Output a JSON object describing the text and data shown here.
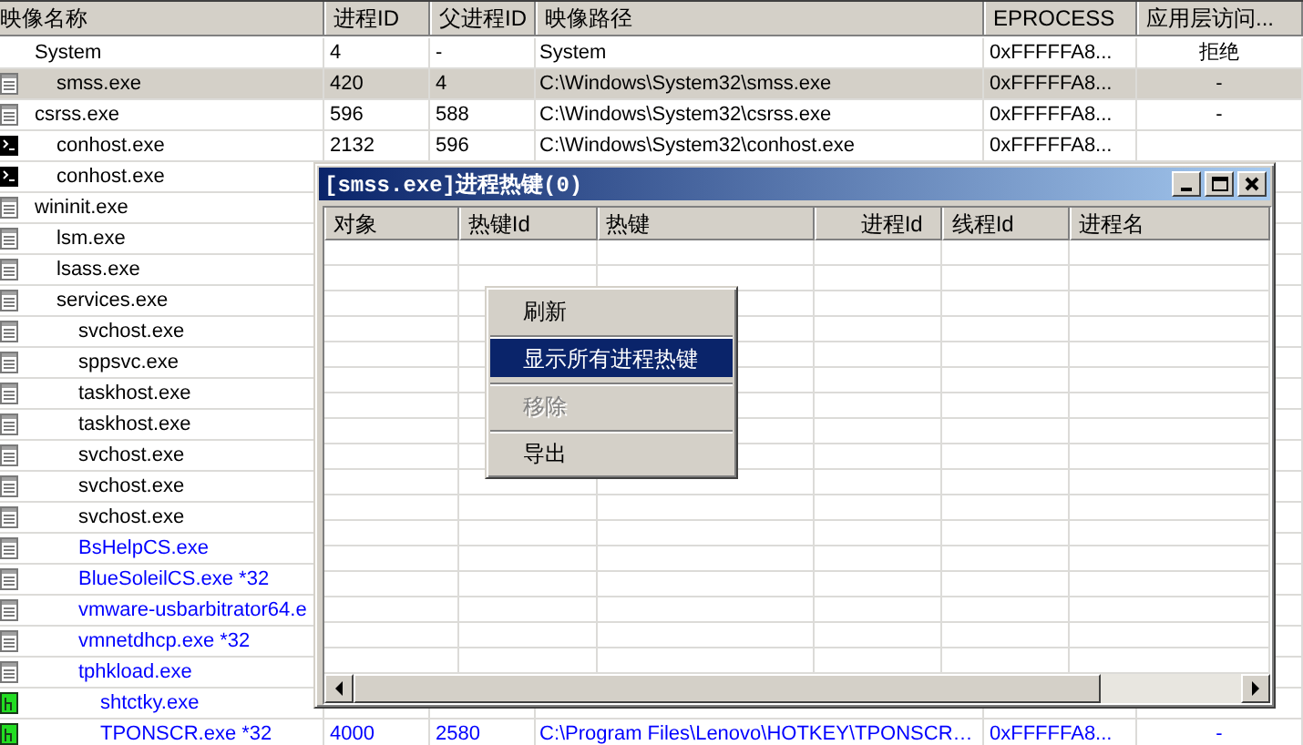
{
  "table": {
    "columns": [
      "映像名称",
      "进程ID",
      "父进程ID",
      "映像路径",
      "EPROCESS",
      "应用层访问..."
    ],
    "rows": [
      {
        "name": "System",
        "pid": "4",
        "ppid": "-",
        "path": "System",
        "eprocess": "0xFFFFFA8...",
        "access": "拒绝",
        "kind": "system",
        "selected": false,
        "color": "#000000",
        "children": [
          {
            "name": "smss.exe",
            "pid": "420",
            "ppid": "4",
            "path": "C:\\Windows\\System32\\smss.exe",
            "eprocess": "0xFFFFFA8...",
            "access": "-",
            "kind": "app",
            "selected": true,
            "color": "#000000"
          }
        ]
      },
      {
        "name": "csrss.exe",
        "pid": "596",
        "ppid": "588",
        "path": "C:\\Windows\\System32\\csrss.exe",
        "eprocess": "0xFFFFFA8...",
        "access": "-",
        "kind": "app",
        "selected": false,
        "color": "#000000",
        "children": [
          {
            "name": "conhost.exe",
            "pid": "2132",
            "ppid": "596",
            "path": "C:\\Windows\\System32\\conhost.exe",
            "eprocess": "0xFFFFFA8...",
            "kind": "console",
            "selected": false,
            "color": "#000000"
          },
          {
            "name": "conhost.exe",
            "kind": "console",
            "selected": false,
            "color": "#000000"
          }
        ]
      },
      {
        "name": "wininit.exe",
        "kind": "app",
        "selected": false,
        "color": "#000000",
        "children": [
          {
            "name": "lsm.exe",
            "kind": "app",
            "selected": false,
            "color": "#000000"
          },
          {
            "name": "lsass.exe",
            "kind": "app",
            "selected": false,
            "color": "#000000"
          },
          {
            "name": "services.exe",
            "kind": "app",
            "selected": false,
            "color": "#000000",
            "children": [
              {
                "name": "svchost.exe",
                "kind": "app",
                "selected": false,
                "color": "#000000"
              },
              {
                "name": "sppsvc.exe",
                "kind": "app",
                "selected": false,
                "color": "#000000"
              },
              {
                "name": "taskhost.exe",
                "kind": "app",
                "selected": false,
                "color": "#000000"
              },
              {
                "name": "taskhost.exe",
                "kind": "app",
                "selected": false,
                "color": "#000000"
              },
              {
                "name": "svchost.exe",
                "kind": "app",
                "selected": false,
                "color": "#000000"
              },
              {
                "name": "svchost.exe",
                "kind": "app",
                "selected": false,
                "color": "#000000"
              },
              {
                "name": "svchost.exe",
                "kind": "app",
                "selected": false,
                "color": "#000000"
              },
              {
                "name": "BsHelpCS.exe",
                "kind": "app",
                "selected": false,
                "color": "#0000ff"
              },
              {
                "name": "BlueSoleilCS.exe *32",
                "kind": "app",
                "selected": false,
                "color": "#0000ff"
              },
              {
                "name": "vmware-usbarbitrator64.e",
                "kind": "app",
                "selected": false,
                "color": "#0000ff"
              },
              {
                "name": "vmnetdhcp.exe *32",
                "kind": "app",
                "selected": false,
                "color": "#0000ff"
              },
              {
                "name": "tphkload.exe",
                "kind": "app",
                "selected": false,
                "color": "#0000ff",
                "children": [
                  {
                    "name": "shtctky.exe",
                    "kind": "hotkey",
                    "selected": false,
                    "color": "#0000ff"
                  },
                  {
                    "name": "TPONSCR.exe *32",
                    "pid": "4000",
                    "ppid": "2580",
                    "path": "C:\\Program Files\\Lenovo\\HOTKEY\\TPONSCR…",
                    "eprocess": "0xFFFFFA8...",
                    "access": "-",
                    "kind": "hotkey",
                    "selected": false,
                    "color": "#0000ff"
                  }
                ]
              }
            ]
          }
        ]
      }
    ]
  },
  "dialog": {
    "title": "[smss.exe]进程热键(0)",
    "columns": [
      "对象",
      "热键Id",
      "热键",
      "进程Id",
      "线程Id",
      "进程名"
    ],
    "context_menu": [
      {
        "label": "刷新",
        "selected": false,
        "disabled": false
      },
      {
        "label": "显示所有进程热键",
        "selected": true,
        "disabled": false
      },
      {
        "label": "移除",
        "selected": false,
        "disabled": true
      },
      {
        "label": "导出",
        "selected": false,
        "disabled": false
      }
    ]
  }
}
